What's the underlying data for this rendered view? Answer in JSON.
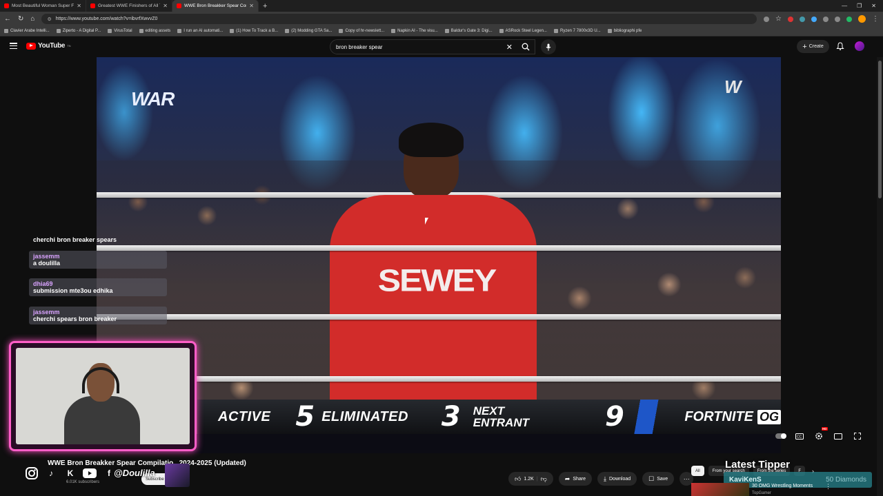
{
  "browser": {
    "tabs": [
      {
        "title": "Most Beautiful Woman Super Fin",
        "active": false
      },
      {
        "title": "Greatest WWE Finishers of All Tim",
        "active": false
      },
      {
        "title": "WWE Bron Breakker Spear Compi",
        "active": true
      }
    ],
    "new_tab": "+",
    "url": "https://www.youtube.com/watch?v=ibvrfXwvvZ0",
    "bookmarks": [
      "Clavier Arabe Intelli...",
      "Ziperto - A Digital P...",
      "VirusTotal",
      "editing assets",
      "I run an AI automati...",
      "(1) How To Track a B...",
      "(2) Modding GTA Sa...",
      "Copy of hr-newslett...",
      "Napkin AI - The visu...",
      "Baldur's Gate 3: Digi...",
      "ASRock Steel Legen...",
      "Ryzen 7 7800x3D U...",
      "bibliographi pfe"
    ]
  },
  "youtube": {
    "logo_text": "YouTube",
    "logo_sup": "TN",
    "search_value": "bron breaker spear",
    "create_label": "Create",
    "colors": {
      "accent": "#ff0000",
      "overlay": "#ff5ec8"
    }
  },
  "video": {
    "war_logo": "WAR",
    "wwe_logo": "W",
    "shirt_text": "SEWEY",
    "scoreboard": {
      "active_label": "ACTIVE",
      "active_value": "5",
      "eliminated_label": "ELIMINATED",
      "eliminated_value": "3",
      "next_line1": "NEXT",
      "next_line2": "ENTRANT",
      "next_value": "9",
      "brand": "FORTNITE",
      "brand_badge": "OG"
    }
  },
  "overlay": {
    "chat": [
      {
        "user": "",
        "message": "cherchi bron breaker spears"
      },
      {
        "user": "jassemm",
        "message": "a doulilla"
      },
      {
        "user": "dhia69",
        "message": "submission mte3ou edhika"
      },
      {
        "user": "jassemm",
        "message": "cherchi spears bron breaker"
      }
    ],
    "handle": "@Doulilla",
    "latest_tipper_title": "Latest Tipper",
    "tipper_name": "KaviKenS",
    "tipper_amount": "50 Diamonds"
  },
  "info": {
    "title": "WWE Bron Breakker Spear Compilatio...2024-2025 (Updated)",
    "subscribers": "6.01K subscribers",
    "subscribe_label": "Subscribe",
    "like_count": "1.2K",
    "share_label": "Share",
    "download_label": "Download",
    "save_label": "Save"
  },
  "sidebar": {
    "chips": [
      "All",
      "From your search",
      "From the series",
      "F"
    ],
    "rec_title": "30 OMG Wrestling Moments",
    "rec_channel": "TopGamer"
  }
}
